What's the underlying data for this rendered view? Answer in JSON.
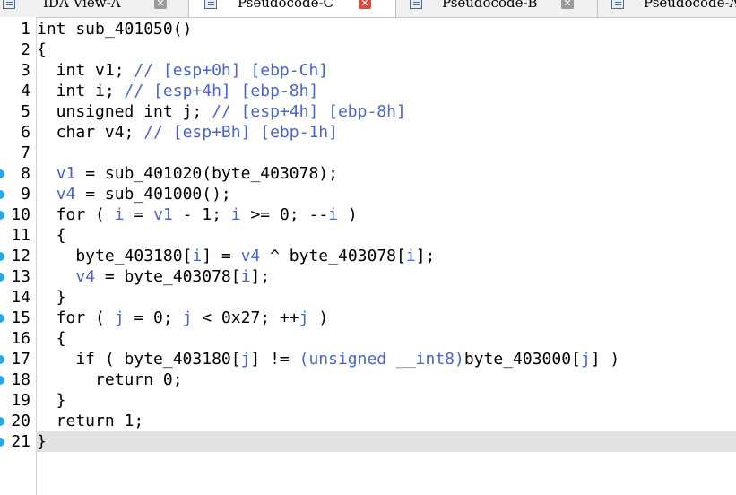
{
  "tabs": [
    {
      "label": "IDA View-A",
      "active": false
    },
    {
      "label": "Pseudocode-C",
      "active": true
    },
    {
      "label": "Pseudocode-B",
      "active": false
    },
    {
      "label": "Pseudocode-A",
      "active": false
    }
  ],
  "current_line": 21,
  "breakpoint_lines": [
    8,
    9,
    10,
    12,
    13,
    15,
    17,
    18,
    20,
    21
  ],
  "colors": {
    "variable": "#4a64c8",
    "breakpoint_dot": "#29a6e8",
    "current_line_bg": "#e2e2e2"
  },
  "lines": [
    {
      "n": "1",
      "segs": [
        {
          "t": "int sub_401050()",
          "c": ""
        }
      ]
    },
    {
      "n": "2",
      "segs": [
        {
          "t": "{",
          "c": ""
        }
      ]
    },
    {
      "n": "3",
      "segs": [
        {
          "t": "  int v1; ",
          "c": ""
        },
        {
          "t": "// [esp+0h] [ebp-Ch]",
          "c": "cm"
        }
      ]
    },
    {
      "n": "4",
      "segs": [
        {
          "t": "  int i; ",
          "c": ""
        },
        {
          "t": "// [esp+4h] [ebp-8h]",
          "c": "cm"
        }
      ]
    },
    {
      "n": "5",
      "segs": [
        {
          "t": "  unsigned int j; ",
          "c": ""
        },
        {
          "t": "// [esp+4h] [ebp-8h]",
          "c": "cm"
        }
      ]
    },
    {
      "n": "6",
      "segs": [
        {
          "t": "  char v4; ",
          "c": ""
        },
        {
          "t": "// [esp+Bh] [ebp-1h]",
          "c": "cm"
        }
      ]
    },
    {
      "n": "7",
      "segs": []
    },
    {
      "n": "8",
      "segs": [
        {
          "t": "  ",
          "c": ""
        },
        {
          "t": "v1",
          "c": "v"
        },
        {
          "t": " = sub_401020(byte_403078);",
          "c": ""
        }
      ]
    },
    {
      "n": "9",
      "segs": [
        {
          "t": "  ",
          "c": ""
        },
        {
          "t": "v4",
          "c": "v"
        },
        {
          "t": " = sub_401000();",
          "c": ""
        }
      ]
    },
    {
      "n": "10",
      "segs": [
        {
          "t": "  for ( ",
          "c": ""
        },
        {
          "t": "i",
          "c": "v"
        },
        {
          "t": " = ",
          "c": ""
        },
        {
          "t": "v1",
          "c": "v"
        },
        {
          "t": " - 1; ",
          "c": ""
        },
        {
          "t": "i",
          "c": "v"
        },
        {
          "t": " >= 0; --",
          "c": ""
        },
        {
          "t": "i",
          "c": "v"
        },
        {
          "t": " )",
          "c": ""
        }
      ]
    },
    {
      "n": "11",
      "segs": [
        {
          "t": "  {",
          "c": ""
        }
      ]
    },
    {
      "n": "12",
      "segs": [
        {
          "t": "    byte_403180[",
          "c": ""
        },
        {
          "t": "i",
          "c": "v"
        },
        {
          "t": "] = ",
          "c": ""
        },
        {
          "t": "v4",
          "c": "v"
        },
        {
          "t": " ^ byte_403078[",
          "c": ""
        },
        {
          "t": "i",
          "c": "v"
        },
        {
          "t": "];",
          "c": ""
        }
      ]
    },
    {
      "n": "13",
      "segs": [
        {
          "t": "    ",
          "c": ""
        },
        {
          "t": "v4",
          "c": "v"
        },
        {
          "t": " = byte_403078[",
          "c": ""
        },
        {
          "t": "i",
          "c": "v"
        },
        {
          "t": "];",
          "c": ""
        }
      ]
    },
    {
      "n": "14",
      "segs": [
        {
          "t": "  }",
          "c": ""
        }
      ]
    },
    {
      "n": "15",
      "segs": [
        {
          "t": "  for ( ",
          "c": ""
        },
        {
          "t": "j",
          "c": "v"
        },
        {
          "t": " = 0; ",
          "c": ""
        },
        {
          "t": "j",
          "c": "v"
        },
        {
          "t": " < 0x27; ++",
          "c": ""
        },
        {
          "t": "j",
          "c": "v"
        },
        {
          "t": " )",
          "c": ""
        }
      ]
    },
    {
      "n": "16",
      "segs": [
        {
          "t": "  {",
          "c": ""
        }
      ]
    },
    {
      "n": "17",
      "segs": [
        {
          "t": "    if ( byte_403180[",
          "c": ""
        },
        {
          "t": "j",
          "c": "v"
        },
        {
          "t": "] != ",
          "c": ""
        },
        {
          "t": "(unsigned __int8)",
          "c": "cm"
        },
        {
          "t": "byte_403000[",
          "c": ""
        },
        {
          "t": "j",
          "c": "v"
        },
        {
          "t": "] )",
          "c": ""
        }
      ]
    },
    {
      "n": "18",
      "segs": [
        {
          "t": "      return 0;",
          "c": ""
        }
      ]
    },
    {
      "n": "19",
      "segs": [
        {
          "t": "  }",
          "c": ""
        }
      ]
    },
    {
      "n": "20",
      "segs": [
        {
          "t": "  return 1;",
          "c": ""
        }
      ]
    },
    {
      "n": "21",
      "segs": [
        {
          "t": "}",
          "c": ""
        }
      ]
    }
  ]
}
